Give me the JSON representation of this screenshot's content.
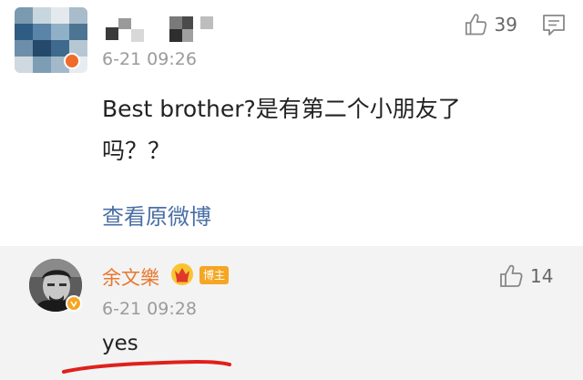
{
  "comment": {
    "time": "6-21 09:26",
    "text": "Best brother?是有第二个小朋友了吗？？",
    "view_original": "查看原微博",
    "like_count": "39"
  },
  "reply": {
    "author": "余文樂",
    "badge": "博主",
    "time": "6-21 09:28",
    "text": "yes",
    "like_count": "14"
  },
  "colors": {
    "link": "#4a6fa5",
    "author_name": "#e8772e",
    "badge_bg": "#f5a623",
    "reply_bg": "#f3f3f3",
    "annotation": "#e0201c"
  },
  "icons": [
    "thumbs-up-icon",
    "comment-icon",
    "crown-icon",
    "verified-badge-icon"
  ]
}
